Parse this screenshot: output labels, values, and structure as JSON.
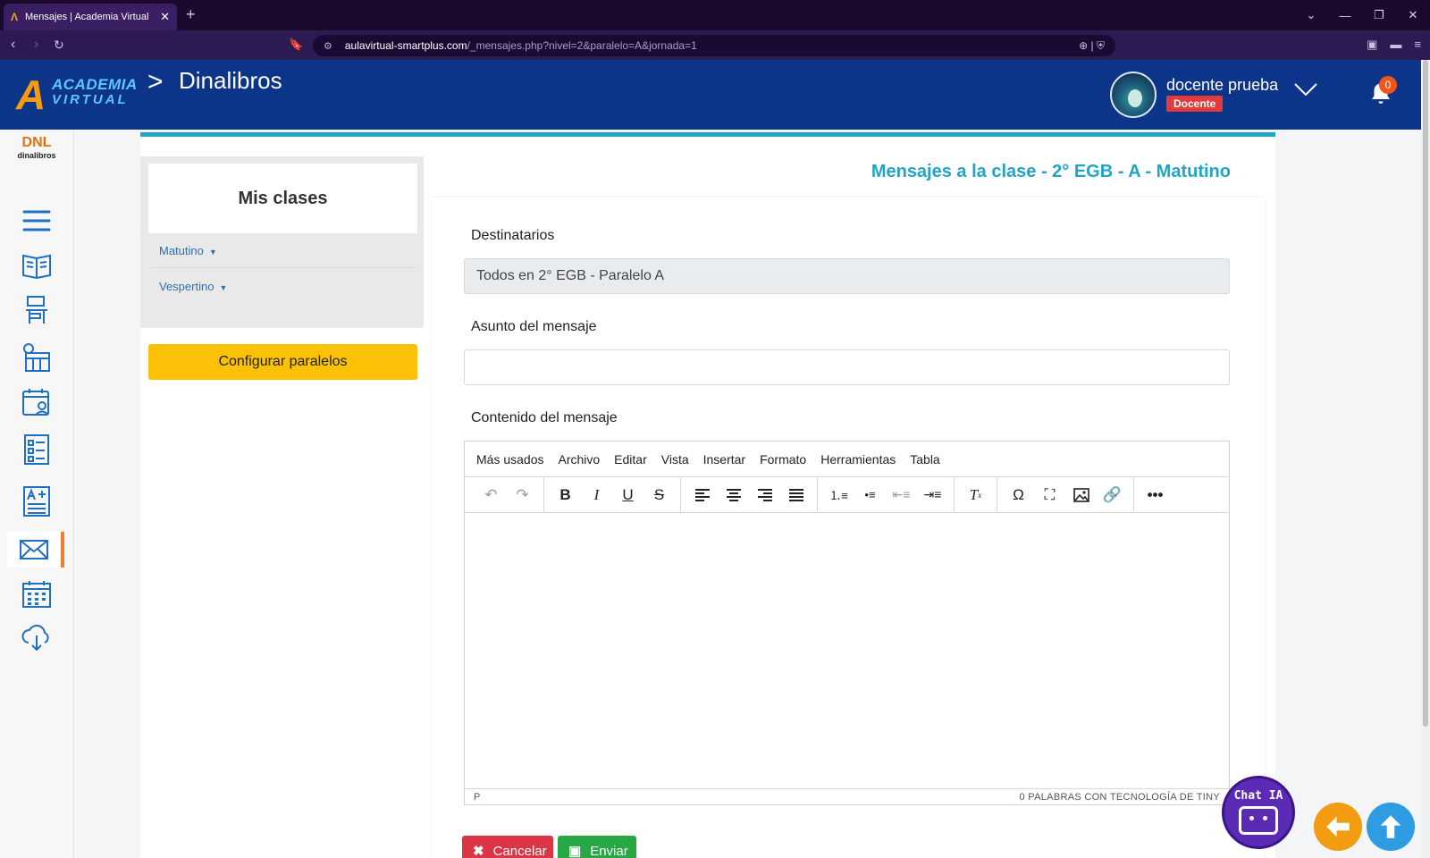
{
  "browser": {
    "tab_title": "Mensajes | Academia Virtual",
    "tab_close": "✕",
    "new_tab": "+",
    "url_host": "aulavirtual-smartplus.com",
    "url_path": "/_mensajes.php?nivel=2&paralelo=A&jornada=1"
  },
  "header": {
    "logo_line1": "ACADEMIA",
    "logo_line2": "VIRTUAL",
    "breadcrumb_sep": ">",
    "title": "Dinalibros",
    "user_name": "docente prueba",
    "user_role": "Docente",
    "notification_count": "0"
  },
  "sidebar": {
    "brand_mark": "DNL",
    "brand_name": "dinalibros",
    "items": [
      {
        "icon": "hamburger-icon"
      },
      {
        "icon": "book-icon"
      },
      {
        "icon": "desk-icon"
      },
      {
        "icon": "schedule-icon"
      },
      {
        "icon": "calendar-user-icon"
      },
      {
        "icon": "checklist-icon"
      },
      {
        "icon": "grades-icon"
      },
      {
        "icon": "mail-icon",
        "active": true
      },
      {
        "icon": "calendar-icon"
      },
      {
        "icon": "cloud-download-icon"
      }
    ]
  },
  "classes": {
    "heading": "Mis clases",
    "jornadas": [
      "Matutino",
      "Vespertino"
    ],
    "config_button": "Configurar paralelos"
  },
  "form": {
    "page_title": "Mensajes a la clase - 2° EGB - A - Matutino",
    "recipients_label": "Destinatarios",
    "recipients_value": "Todos en 2° EGB - Paralelo A",
    "subject_label": "Asunto del mensaje",
    "subject_value": "",
    "content_label": "Contenido del mensaje",
    "editor_menu": [
      "Más usados",
      "Archivo",
      "Editar",
      "Vista",
      "Insertar",
      "Formato",
      "Herramientas",
      "Tabla"
    ],
    "status_path": "P",
    "status_right": "0 PALABRAS  CON TECNOLOGÍA DE TINY",
    "cancel_label": "Cancelar",
    "send_label": "Enviar"
  },
  "widgets": {
    "chat_label": "Chat IA"
  },
  "colors": {
    "header_bg": "#0c3488",
    "accent_teal": "#23a4c4",
    "config_yellow": "#fbc107",
    "cancel_red": "#dc3545",
    "send_green": "#28a745"
  }
}
